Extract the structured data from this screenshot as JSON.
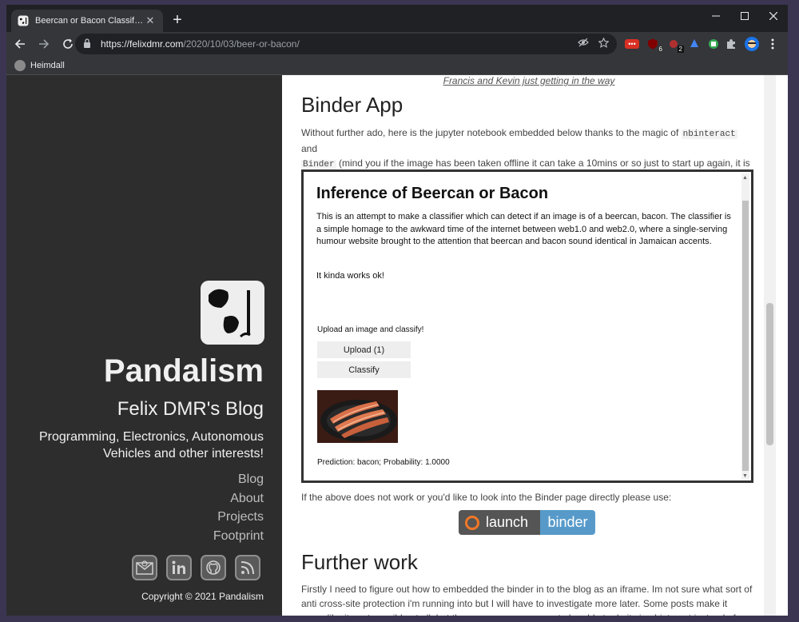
{
  "browser": {
    "tab_title": "Beercan or Bacon Classifier – Pan",
    "tab_close": "✕",
    "new_tab": "+",
    "url_host": "https://felixdmr.com",
    "url_path": "/2020/10/03/beer-or-bacon/",
    "bookmark": "Heimdall",
    "ext_badges": [
      "6",
      "2"
    ]
  },
  "sidebar": {
    "title": "Pandalism",
    "subtitle": "Felix DMR's Blog",
    "description": "Programming, Electronics, Autonomous Vehicles and other interests!",
    "nav": [
      "Blog",
      "About",
      "Projects",
      "Footprint"
    ],
    "social_icons": [
      "email-icon",
      "linkedin-icon",
      "github-icon",
      "rss-icon"
    ],
    "copyright": "Copyright © 2021 Pandalism"
  },
  "content": {
    "caption": "Francis and Kevin just getting in the way",
    "binder_heading": "Binder App",
    "intro_1": "Without further ado, here is the jupyter notebook embedded below thanks to the magic of",
    "intro_code1": "nbinteract",
    "intro_and": "and",
    "intro_code2": "Binder",
    "intro_2": "(mind you if the image has been taken offline it can take a 10mins or so just to start up again, it is a free service after all...):",
    "notebook": {
      "title": "Inference of Beercan or Bacon",
      "para1": "This is an attempt to make a classifier which can detect if an image is of a beercan, bacon. The classifier is a simple homage to the awkward time of the internet between web1.0 and web2.0, where a single-serving humour website brought to the attention that beercan and bacon sound identical in Jamaican accents.",
      "para2": "It kinda works ok!",
      "upload_label": "Upload an image and classify!",
      "upload_button": " Upload (1)",
      "classify_button": "Classify",
      "prediction": "Prediction: bacon; Probability: 1.0000"
    },
    "after_iframe": "If the above does not work or you'd like to look into the Binder page directly please use:",
    "badge_left": "launch",
    "badge_right": "binder",
    "further_heading": "Further work",
    "further_para": "Firstly I need to figure out how to embedded the binder in to the blog as an iframe. Im not sure what sort of anti cross-site protection i'm running into but I will have to investigate more later. Some posts make it seem like its not possible at all, but then some users appear to be able to do it via nbinteract instead of voila"
  }
}
